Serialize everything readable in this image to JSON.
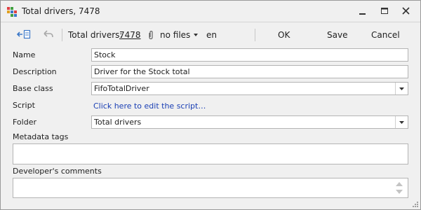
{
  "window": {
    "title": "Total drivers, 7478",
    "icon": "hierarchy-grid-icon"
  },
  "toolbar": {
    "back_icon": "arrow-to-panel-icon",
    "undo_icon": "undo-arrow-icon",
    "label": "Total drivers:",
    "id_value": "7478",
    "attach_icon": "paperclip-icon",
    "files_label": "no files",
    "language": "en",
    "ok_label": "OK",
    "save_label": "Save",
    "cancel_label": "Cancel"
  },
  "form": {
    "name_label": "Name",
    "name_value": "Stock",
    "description_label": "Description",
    "description_value": "Driver for the Stock total",
    "base_class_label": "Base class",
    "base_class_value": "FifoTotalDriver",
    "script_label": "Script",
    "script_link": "Click here to edit the script…",
    "folder_label": "Folder",
    "folder_value": "Total drivers",
    "metadata_tags_label": "Metadata tags",
    "metadata_tags_value": "",
    "comments_label": "Developer's comments",
    "comments_value": ""
  },
  "colors": {
    "background": "#f0f0f0",
    "link": "#1a3fb4",
    "icon_accent": "#3c78c8"
  }
}
